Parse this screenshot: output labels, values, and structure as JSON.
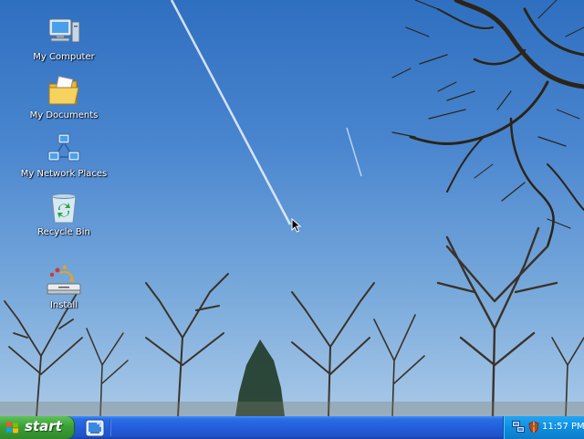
{
  "desktop": {
    "icons": [
      {
        "label": "My Computer",
        "icon": "my-computer-icon"
      },
      {
        "label": "My Documents",
        "icon": "my-documents-icon"
      },
      {
        "label": "My Network Places",
        "icon": "network-places-icon"
      },
      {
        "label": "Recycle Bin",
        "icon": "recycle-bin-icon"
      },
      {
        "label": "Install",
        "icon": "install-icon"
      }
    ]
  },
  "taskbar": {
    "start_label": "start",
    "quick_launch": [
      "show-desktop-icon"
    ],
    "tray": {
      "icons": [
        "network-connection-icon",
        "security-shield-icon"
      ],
      "clock": "11:57 PM"
    }
  },
  "colors": {
    "sky_top": "#2f6fc0",
    "sky_bottom": "#a9c9e8",
    "taskbar": "#245edb",
    "start_button": "#3c9e37",
    "tray": "#0f8ee0"
  }
}
